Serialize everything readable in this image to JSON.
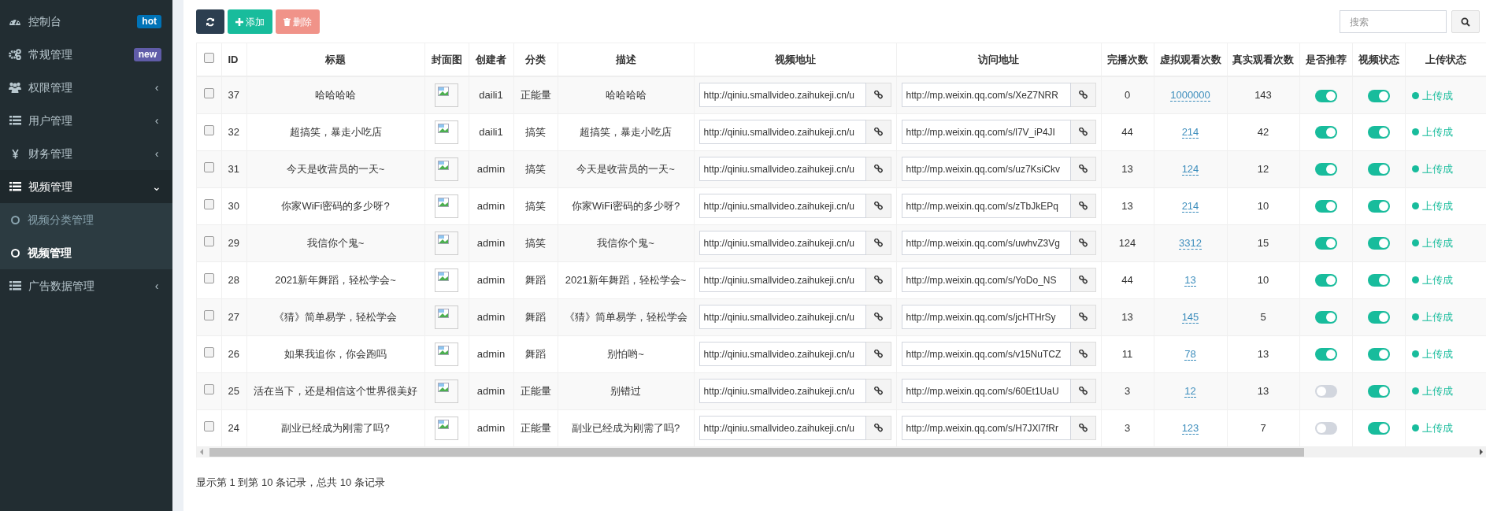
{
  "sidebar": {
    "items": [
      {
        "label": "控制台",
        "badge": {
          "text": "hot",
          "color": "#0073b7"
        },
        "expanded": false,
        "selected": false
      },
      {
        "label": "常规管理",
        "badge": {
          "text": "new",
          "color": "#605ca8"
        },
        "expanded": false,
        "selected": false
      },
      {
        "label": "权限管理",
        "arrow": "‹",
        "expanded": false,
        "selected": false
      },
      {
        "label": "用户管理",
        "arrow": "‹",
        "expanded": false,
        "selected": false
      },
      {
        "label": "财务管理",
        "arrow": "‹",
        "expanded": false,
        "selected": false
      },
      {
        "label": "视频管理",
        "arrow": "⌄",
        "expanded": true,
        "selected": false,
        "children": [
          {
            "label": "视频分类管理",
            "selected": false
          },
          {
            "label": "视频管理",
            "selected": true
          }
        ]
      },
      {
        "label": "广告数据管理",
        "arrow": "‹",
        "expanded": false,
        "selected": false
      }
    ]
  },
  "toolbar": {
    "buttons": [
      {
        "kind": "refresh",
        "disabled": false
      },
      {
        "kind": "add",
        "label": "添加",
        "disabled": false
      },
      {
        "kind": "delete",
        "label": "删除",
        "disabled": true
      }
    ],
    "search": {
      "placeholder": "搜索"
    }
  },
  "table": {
    "all_checked": false,
    "columns": [
      "ID",
      "标题",
      "封面图",
      "创建者",
      "分类",
      "描述",
      "视频地址",
      "访问地址",
      "完播次数",
      "虚拟观看次数",
      "真实观看次数",
      "是否推荐",
      "视频状态",
      "上传状态"
    ],
    "rows": [
      {
        "checked": false,
        "id": "37",
        "title": "哈哈哈哈",
        "creator": "daili1",
        "category": "正能量",
        "description": "哈哈哈哈",
        "video_url": "http://qiniu.smallvideo.zaihukeji.cn/u",
        "visit_url": "http://mp.weixin.qq.com/s/XeZ7NRR",
        "completed_plays": "0",
        "virtual_views": "1000000",
        "real_views": "143",
        "recommended": true,
        "video_status": true,
        "upload_status": {
          "text": "上传成",
          "color": "#18bc9c"
        }
      },
      {
        "checked": false,
        "id": "32",
        "title": "超搞笑，暴走小吃店",
        "creator": "daili1",
        "category": "搞笑",
        "description": "超搞笑，暴走小吃店",
        "video_url": "http://qiniu.smallvideo.zaihukeji.cn/u",
        "visit_url": "http://mp.weixin.qq.com/s/l7V_iP4JI",
        "completed_plays": "44",
        "virtual_views": "214",
        "real_views": "42",
        "recommended": true,
        "video_status": true,
        "upload_status": {
          "text": "上传成",
          "color": "#18bc9c"
        }
      },
      {
        "checked": false,
        "id": "31",
        "title": "今天是收营员的一天~",
        "creator": "admin",
        "category": "搞笑",
        "description": "今天是收营员的一天~",
        "video_url": "http://qiniu.smallvideo.zaihukeji.cn/u",
        "visit_url": "http://mp.weixin.qq.com/s/uz7KsiCkv",
        "completed_plays": "13",
        "virtual_views": "124",
        "real_views": "12",
        "recommended": true,
        "video_status": true,
        "upload_status": {
          "text": "上传成",
          "color": "#18bc9c"
        }
      },
      {
        "checked": false,
        "id": "30",
        "title": "你家WiFi密码的多少呀?",
        "creator": "admin",
        "category": "搞笑",
        "description": "你家WiFi密码的多少呀?",
        "video_url": "http://qiniu.smallvideo.zaihukeji.cn/u",
        "visit_url": "http://mp.weixin.qq.com/s/zTbJkEPq",
        "completed_plays": "13",
        "virtual_views": "214",
        "real_views": "10",
        "recommended": true,
        "video_status": true,
        "upload_status": {
          "text": "上传成",
          "color": "#18bc9c"
        }
      },
      {
        "checked": false,
        "id": "29",
        "title": "我信你个鬼~",
        "creator": "admin",
        "category": "搞笑",
        "description": "我信你个鬼~",
        "video_url": "http://qiniu.smallvideo.zaihukeji.cn/u",
        "visit_url": "http://mp.weixin.qq.com/s/uwhvZ3Vg",
        "completed_plays": "124",
        "virtual_views": "3312",
        "real_views": "15",
        "recommended": true,
        "video_status": true,
        "upload_status": {
          "text": "上传成",
          "color": "#18bc9c"
        }
      },
      {
        "checked": false,
        "id": "28",
        "title": "2021新年舞蹈，轻松学会~",
        "creator": "admin",
        "category": "舞蹈",
        "description": "2021新年舞蹈，轻松学会~",
        "video_url": "http://qiniu.smallvideo.zaihukeji.cn/u",
        "visit_url": "http://mp.weixin.qq.com/s/YoDo_NS",
        "completed_plays": "44",
        "virtual_views": "13",
        "real_views": "10",
        "recommended": true,
        "video_status": true,
        "upload_status": {
          "text": "上传成",
          "color": "#18bc9c"
        }
      },
      {
        "checked": false,
        "id": "27",
        "title": "《猜》简单易学，轻松学会",
        "creator": "admin",
        "category": "舞蹈",
        "description": "《猜》简单易学，轻松学会",
        "video_url": "http://qiniu.smallvideo.zaihukeji.cn/u",
        "visit_url": "http://mp.weixin.qq.com/s/jcHTHrSy",
        "completed_plays": "13",
        "virtual_views": "145",
        "real_views": "5",
        "recommended": true,
        "video_status": true,
        "upload_status": {
          "text": "上传成",
          "color": "#18bc9c"
        }
      },
      {
        "checked": false,
        "id": "26",
        "title": "如果我追你，你会跑吗",
        "creator": "admin",
        "category": "舞蹈",
        "description": "别怕哟~",
        "video_url": "http://qiniu.smallvideo.zaihukeji.cn/u",
        "visit_url": "http://mp.weixin.qq.com/s/v15NuTCZ",
        "completed_plays": "11",
        "virtual_views": "78",
        "real_views": "13",
        "recommended": true,
        "video_status": true,
        "upload_status": {
          "text": "上传成",
          "color": "#18bc9c"
        }
      },
      {
        "checked": false,
        "id": "25",
        "title": "活在当下，还是相信这个世界很美好",
        "creator": "admin",
        "category": "正能量",
        "description": "别错过",
        "video_url": "http://qiniu.smallvideo.zaihukeji.cn/u",
        "visit_url": "http://mp.weixin.qq.com/s/60Et1UaU",
        "completed_plays": "3",
        "virtual_views": "12",
        "real_views": "13",
        "recommended": false,
        "video_status": true,
        "upload_status": {
          "text": "上传成",
          "color": "#18bc9c"
        }
      },
      {
        "checked": false,
        "id": "24",
        "title": "副业已经成为刚需了吗?",
        "creator": "admin",
        "category": "正能量",
        "description": "副业已经成为刚需了吗?",
        "video_url": "http://qiniu.smallvideo.zaihukeji.cn/u",
        "visit_url": "http://mp.weixin.qq.com/s/H7JXl7fRr",
        "completed_plays": "3",
        "virtual_views": "123",
        "real_views": "7",
        "recommended": false,
        "video_status": true,
        "upload_status": {
          "text": "上传成",
          "color": "#18bc9c"
        }
      }
    ]
  },
  "footer": {
    "summary": "显示第 1 到第 10 条记录，总共 10 条记录"
  }
}
